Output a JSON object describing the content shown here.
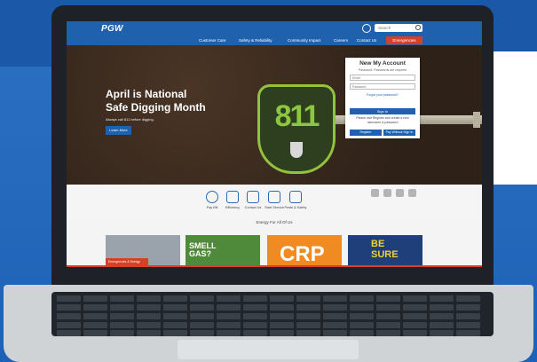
{
  "site": {
    "logo": "PGW"
  },
  "search": {
    "placeholder": "Search"
  },
  "nav": {
    "items": [
      "Customer Care",
      "Safety & Reliability",
      "Community Impact",
      "Careers",
      "Contact Us"
    ],
    "emergencies": "Emergencies"
  },
  "hero": {
    "title": "April is National Safe Digging Month",
    "subtitle": "Always call 811 before digging.",
    "button": "Learn More",
    "badge_number": "811"
  },
  "login": {
    "title": "New My Account",
    "note": "Password: Passwords are required",
    "email_placeholder": "Email",
    "password_placeholder": "Password",
    "forgot_link": "Forgot your password?",
    "signin": "Sign In",
    "register_text": "Please visit Register and create a new username & password",
    "register": "Register",
    "pay": "Pay Without Sign In"
  },
  "carousel": {
    "prev": "‹",
    "pause": "❚❚",
    "next": "›"
  },
  "quick_links": [
    {
      "label": "Pay Bill",
      "icon": "dollar-icon"
    },
    {
      "label": "Efficiency",
      "icon": "recycle-icon"
    },
    {
      "label": "Contact Us",
      "icon": "phone-icon"
    },
    {
      "label": "Start Service",
      "icon": "tools-icon"
    },
    {
      "label": "Pests & Safety",
      "icon": "house-icon"
    }
  ],
  "social": [
    "instagram-icon",
    "twitter-icon",
    "facebook-icon",
    "youtube-icon"
  ],
  "section": {
    "title": "Energy For All Of Us"
  },
  "tiles": [
    {
      "label": "Emergencies & Energy Safety",
      "color": "#9aa3ab"
    },
    {
      "label": "SMELL GAS?",
      "color": "#4f8a3b"
    },
    {
      "label": "CRP",
      "color": "#f08a22"
    },
    {
      "label": "BE SURE",
      "color": "#1f3f7a"
    }
  ],
  "colors": {
    "brand": "#1f61ad",
    "emergency": "#d6402b",
    "accent811": "#8dc63f"
  }
}
